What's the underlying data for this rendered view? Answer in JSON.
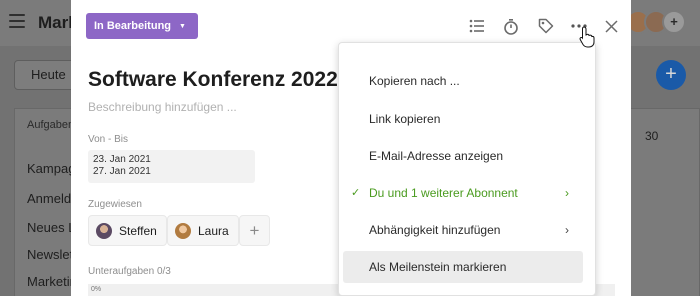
{
  "background": {
    "app_title": "Mark",
    "today_button": "Heute",
    "column_header": "Aufgaben",
    "rows": [
      "Kampag",
      "Anmeld",
      "Neues L",
      "Newslet",
      "Marketin"
    ],
    "day_number": "30",
    "add_button": "+",
    "avatar_plus": "+"
  },
  "task": {
    "status": "In Bearbeitung",
    "title": "Software Konferenz 2022",
    "description_placeholder": "Beschreibung hinzufügen ...",
    "dates_label": "Von - Bis",
    "date_from": "23. Jan 2021",
    "date_to": "27. Jan 2021",
    "assigned_label": "Zugewiesen",
    "assignees": [
      "Steffen",
      "Laura"
    ],
    "add_assignee": "+",
    "subtasks_label": "Unteraufgaben",
    "subtasks_count": "0/3",
    "progress_text": "0%"
  },
  "menu": {
    "items": [
      "Kopieren nach ...",
      "Link kopieren",
      "E-Mail-Adresse anzeigen",
      "Du und 1 weiterer Abonnent",
      "Abhängigkeit hinzufügen",
      "Als Meilenstein markieren"
    ]
  },
  "colors": {
    "status_purple": "#8d67c6",
    "subscriber_green": "#4a9b1f",
    "fab_blue": "#1a5aa8"
  },
  "icons": [
    "list-icon",
    "timer-icon",
    "tag-icon",
    "more-icon",
    "close-icon",
    "check-icon",
    "chevron-right-icon",
    "cursor-icon"
  ]
}
